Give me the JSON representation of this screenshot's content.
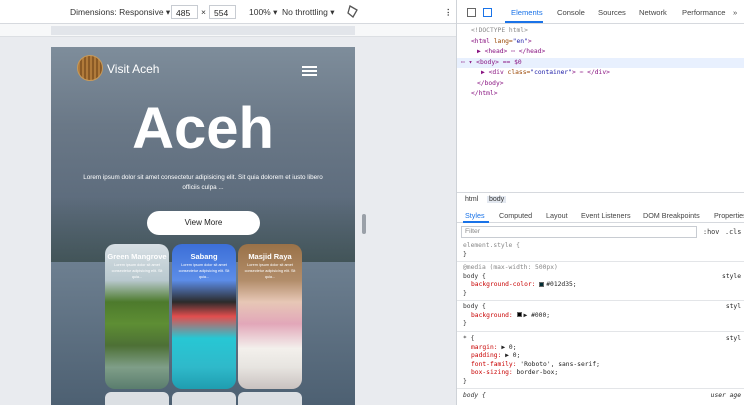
{
  "device_toolbar": {
    "dimensions_label": "Dimensions: Responsive ▾",
    "width": "485",
    "times": "×",
    "height": "554",
    "zoom": "100% ▾",
    "throttle": "No throttling ▾",
    "more": "⋮"
  },
  "site": {
    "brand": "Visit Aceh",
    "hero_title": "Aceh",
    "hero_text": "Lorem ipsum dolor sit amet consectetur adipisicing elit. Sit quia dolorem et iusto libero officiis culpa ...",
    "view_button": "View More",
    "cards": [
      {
        "title": "Green Mangrove",
        "text": "Lorem ipsum dolor sit amet consectetur adipisicing elit. Sit quia..."
      },
      {
        "title": "Sabang",
        "text": "Lorem ipsum dolor sit amet consectetur adipisicing elit. Sit quia..."
      },
      {
        "title": "Masjid Raya",
        "text": "Lorem ipsum dolor sit amet consectetur adipisicing elit. Sit quia..."
      }
    ]
  },
  "devtools": {
    "tabs": [
      "Elements",
      "Console",
      "Sources",
      "Network",
      "Performance",
      "»"
    ],
    "dom": {
      "doctype": "<!DOCTYPE html>",
      "html_open_tag": "<html",
      "html_attr": " lang=",
      "html_attr_val": "\"en\"",
      "html_close": ">",
      "head": "▶ <head> ⋯ </head>",
      "body_line": "⋯ ▾ <body> == $0",
      "div_line_tag": "▶ <div",
      "div_attr": " class=",
      "div_attr_val": "\"container\"",
      "div_rest": "> ⋯ </div>",
      "body_close": "</body>",
      "html_close_tag": "</html>"
    },
    "breadcrumb": [
      "html",
      "body"
    ],
    "styles_tabs": [
      "Styles",
      "Computed",
      "Layout",
      "Event Listeners",
      "DOM Breakpoints",
      "Properties"
    ],
    "filter_placeholder": "Filter",
    "hov": ":hov",
    "cls": ".cls",
    "rules": {
      "element_style": "element.style {",
      "close": "}",
      "media": "@media (max-width: 500px)",
      "body_open": "body {",
      "bg_color_prop": "background-color:",
      "bg_color_val": "#012d35;",
      "bg_color_swatch": "#012d35",
      "bg_prop": "background:",
      "bg_val": "▶ #000;",
      "bg_swatch": "#000000",
      "star_open": "* {",
      "margin": "margin:",
      "margin_val": "▶ 0;",
      "padding": "padding:",
      "padding_val": "▶ 0;",
      "font_family": "font-family:",
      "font_family_val": "'Roboto', sans-serif;",
      "box_sizing": "box-sizing:",
      "box_sizing_val": "border-box;",
      "src_style": "style",
      "src_style2": "styl",
      "ua_body": "body {",
      "ua_label": "user age"
    }
  }
}
